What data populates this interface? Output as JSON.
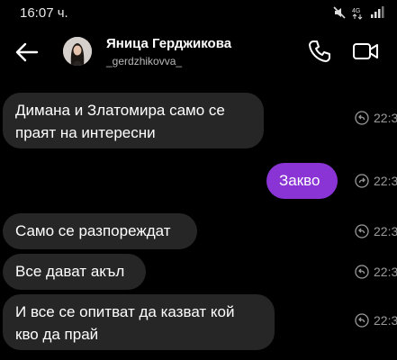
{
  "status_bar": {
    "time": "16:07 ч."
  },
  "header": {
    "contact_name": "Яница Герджикова",
    "username": "_gerdzhikovva_"
  },
  "messages": [
    {
      "text_lines": [
        "Димана и Златомира само се",
        "праят на интересни"
      ],
      "time": "22:3",
      "direction": "received"
    },
    {
      "text_lines": [
        "Закво"
      ],
      "time": "22:3",
      "direction": "sent"
    },
    {
      "text_lines": [
        "Само се разпореждат"
      ],
      "time": "22:3",
      "direction": "received"
    },
    {
      "text_lines": [
        "Все дават акъл"
      ],
      "time": "22:3",
      "direction": "received"
    },
    {
      "text_lines": [
        "И все се опитват да казват кой",
        "кво да прай"
      ],
      "time": "22:3",
      "direction": "received"
    }
  ],
  "colors": {
    "sent_bubble": "#8a34d6",
    "received_bubble": "#262626",
    "background": "#000000"
  },
  "icons": [
    "mute-icon",
    "4g-icon",
    "signal-icon",
    "back-arrow-icon",
    "phone-icon",
    "video-call-icon",
    "reply-icon"
  ]
}
